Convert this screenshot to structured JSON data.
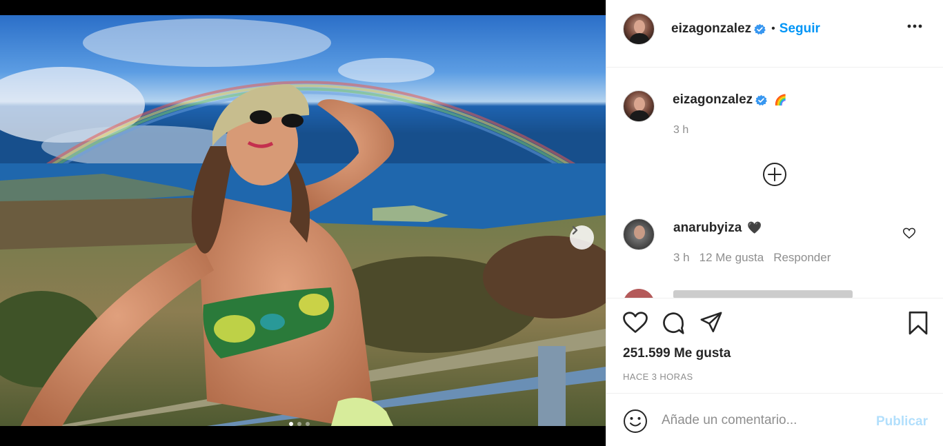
{
  "post": {
    "username": "eizagonzalez",
    "follow_label": "Seguir",
    "separator": "•",
    "caption_emoji": "🌈",
    "time": "3 h",
    "likes": "251.599 Me gusta",
    "time_ago": "HACE 3 HORAS",
    "carousel": {
      "count": 3,
      "active_index": 0
    }
  },
  "comments": [
    {
      "username": "anarubyiza",
      "emoji": "🖤",
      "time": "3 h",
      "likes": "12 Me gusta",
      "reply_label": "Responder"
    }
  ],
  "add_comment": {
    "placeholder": "Añade un comentario...",
    "publish_label": "Publicar"
  },
  "colors": {
    "accent": "#0095f6",
    "verified": "#3897f0",
    "publish_disabled": "#b2dffc",
    "muted": "#8e8e8e"
  },
  "icons": [
    "verified-badge-icon",
    "more-options-icon",
    "add-circle-icon",
    "heart-icon",
    "comment-icon",
    "share-icon",
    "bookmark-icon",
    "emoji-smile-icon",
    "chevron-right-icon"
  ]
}
